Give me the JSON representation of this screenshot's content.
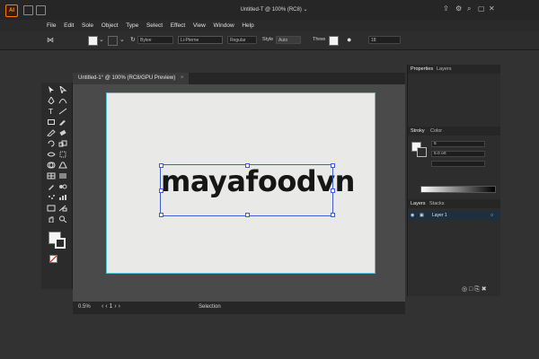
{
  "window": {
    "app_logo": "AI",
    "title": "Untitled-T @ 100% (RC8) ⌄"
  },
  "menu": [
    "File",
    "Edit",
    "Sole",
    "Object",
    "Type",
    "Select",
    "Effect",
    "View",
    "Window",
    "Help"
  ],
  "controlbar": {
    "font_name": "Bylee",
    "stroke_profile": "Li-Pterne",
    "weight": "Regular",
    "style_label": "Style",
    "style_value": "Auto",
    "three_label": "Three",
    "size_value": "18"
  },
  "document": {
    "tab_label": "Untitled-1° @ 100% (RC8/GPU Preview)",
    "tab_close": "×",
    "artboard_text": "mayafoodvn"
  },
  "statusbar": {
    "zoom": "0.5%",
    "tool": "Selection"
  },
  "panels": {
    "top_tabs": [
      "Properties",
      "Layers"
    ],
    "color_tabs": [
      "Stroky",
      "Color"
    ],
    "stroke_weight": "5",
    "stroke_unit": "5.0 ort",
    "layers_tabs": [
      "Layers",
      "Stacks"
    ],
    "layer_name": "Layer 1"
  },
  "colors": {
    "accent_selection": "#3d5fd1",
    "artboard_outline": "#4fbfd6",
    "app_logo": "#ff9a00"
  }
}
